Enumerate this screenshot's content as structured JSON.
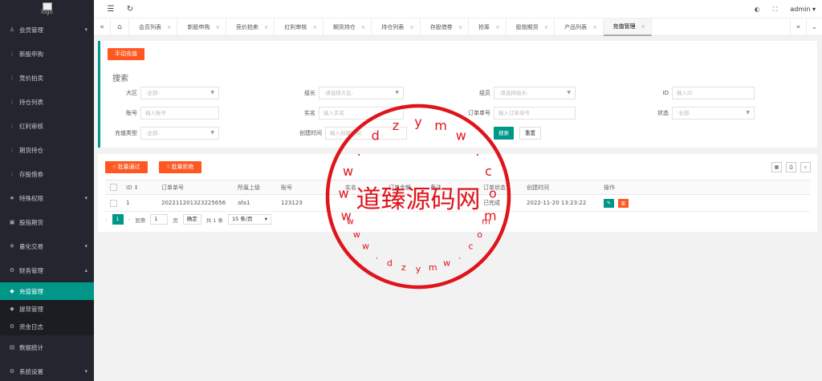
{
  "sidebar": {
    "logo_alt": "logo",
    "items": [
      {
        "label": "会员管理",
        "icon": "user-icon",
        "glyph": "♙",
        "arrow": "▾"
      },
      {
        "label": "新股申购",
        "icon": "dots-icon",
        "glyph": "⋮"
      },
      {
        "label": "竞价拍卖",
        "icon": "dots-icon",
        "glyph": "⋮"
      },
      {
        "label": "持仓列表",
        "icon": "dots-icon",
        "glyph": "⋮"
      },
      {
        "label": "红利审核",
        "icon": "dots-icon",
        "glyph": "⋮"
      },
      {
        "label": "期货持仓",
        "icon": "dots-icon",
        "glyph": "⋮"
      },
      {
        "label": "存股借券",
        "icon": "dots-icon",
        "glyph": "⋮"
      },
      {
        "label": "特殊权限",
        "icon": "star-icon",
        "glyph": "★",
        "arrow": "▾"
      },
      {
        "label": "股指期货",
        "icon": "gift-icon",
        "glyph": "▣"
      },
      {
        "label": "量化交易",
        "icon": "snowflake-icon",
        "glyph": "❄",
        "arrow": "▾"
      },
      {
        "label": "财务管理",
        "icon": "cog-icon",
        "glyph": "⚙",
        "arrow": "▴"
      }
    ],
    "subitems": [
      {
        "label": "充值管理",
        "icon": "diamond-icon",
        "glyph": "◆",
        "active": true
      },
      {
        "label": "提现管理",
        "icon": "diamond-icon",
        "glyph": "◆"
      },
      {
        "label": "资金日志",
        "icon": "cog-icon",
        "glyph": "⚙"
      }
    ],
    "bottom": [
      {
        "label": "数据统计",
        "icon": "chart-icon",
        "glyph": "▤"
      },
      {
        "label": "系统设置",
        "icon": "cog-icon",
        "glyph": "⚙",
        "arrow": "▾"
      }
    ]
  },
  "header": {
    "menu_glyph": "☰",
    "refresh_glyph": "↻",
    "theme_glyph": "◐",
    "fullscreen_glyph": "⛶",
    "user": "admin"
  },
  "tabs": {
    "prev_glyph": "«",
    "home_glyph": "⌂",
    "next_glyph": "»",
    "menu_glyph": "⌄",
    "close_glyph": "×",
    "items": [
      {
        "label": "会员列表"
      },
      {
        "label": "新股申购"
      },
      {
        "label": "竞价拍卖"
      },
      {
        "label": "红利审核"
      },
      {
        "label": "期货持仓"
      },
      {
        "label": "持仓列表"
      },
      {
        "label": "存股借券"
      },
      {
        "label": "抢筹"
      },
      {
        "label": "股指期货"
      },
      {
        "label": "产品列表"
      },
      {
        "label": "充值管理",
        "active": true
      }
    ]
  },
  "main": {
    "manual_recharge": "手动充值",
    "search_title": "搜索",
    "fields": {
      "region": {
        "label": "大区",
        "placeholder": "-全部-"
      },
      "group_leader": {
        "label": "组长",
        "placeholder": "-请选择大区-"
      },
      "member": {
        "label": "组员",
        "placeholder": "-请选择组长-"
      },
      "id": {
        "label": "ID",
        "placeholder": "输入ID"
      },
      "account": {
        "label": "账号",
        "placeholder": "输入账号"
      },
      "real_name": {
        "label": "实名",
        "placeholder": "输入实名"
      },
      "order_no": {
        "label": "订单单号",
        "placeholder": "输入订单单号"
      },
      "status": {
        "label": "状态",
        "placeholder": "-全部-"
      },
      "recharge_type": {
        "label": "充值类型",
        "placeholder": "-全部-"
      },
      "created_time": {
        "label": "创建时间",
        "placeholder": "输入创建时间"
      }
    },
    "search_btn": "搜索",
    "reset_btn": "重置",
    "batch_approve": "批量通过",
    "batch_reject": "批量拒绝",
    "tool_icons": [
      "columns-icon",
      "print-icon",
      "export-icon"
    ],
    "table": {
      "headers": [
        "ID",
        "订单单号",
        "所属上级",
        "账号",
        "实名",
        "订单金额",
        "备注",
        "订单状态",
        "创建时间",
        "操作"
      ],
      "rows": [
        {
          "id": "1",
          "order_no": "20221120132322565​6",
          "parent": "afa1",
          "account": "123123",
          "real_name": "",
          "amount": "",
          "remark": "",
          "status": "已完成",
          "created": "2022-11-20 13:23:22"
        }
      ]
    },
    "pager": {
      "current": "1",
      "goto_label": "到第",
      "goto_value": "1",
      "page_unit": "页",
      "confirm": "确定",
      "total": "共 1 条",
      "per_page": "15 条/页"
    }
  },
  "watermark": {
    "top": [
      "w",
      "w",
      "w",
      ".",
      "d",
      "z",
      "y",
      "m",
      "w",
      ".",
      "c",
      "o",
      "m"
    ],
    "center": "道臻源码网",
    "bottom": [
      "w",
      "w",
      "w",
      ".",
      "d",
      "z",
      "y",
      "m",
      "w",
      ".",
      "c",
      "o",
      "m"
    ]
  }
}
